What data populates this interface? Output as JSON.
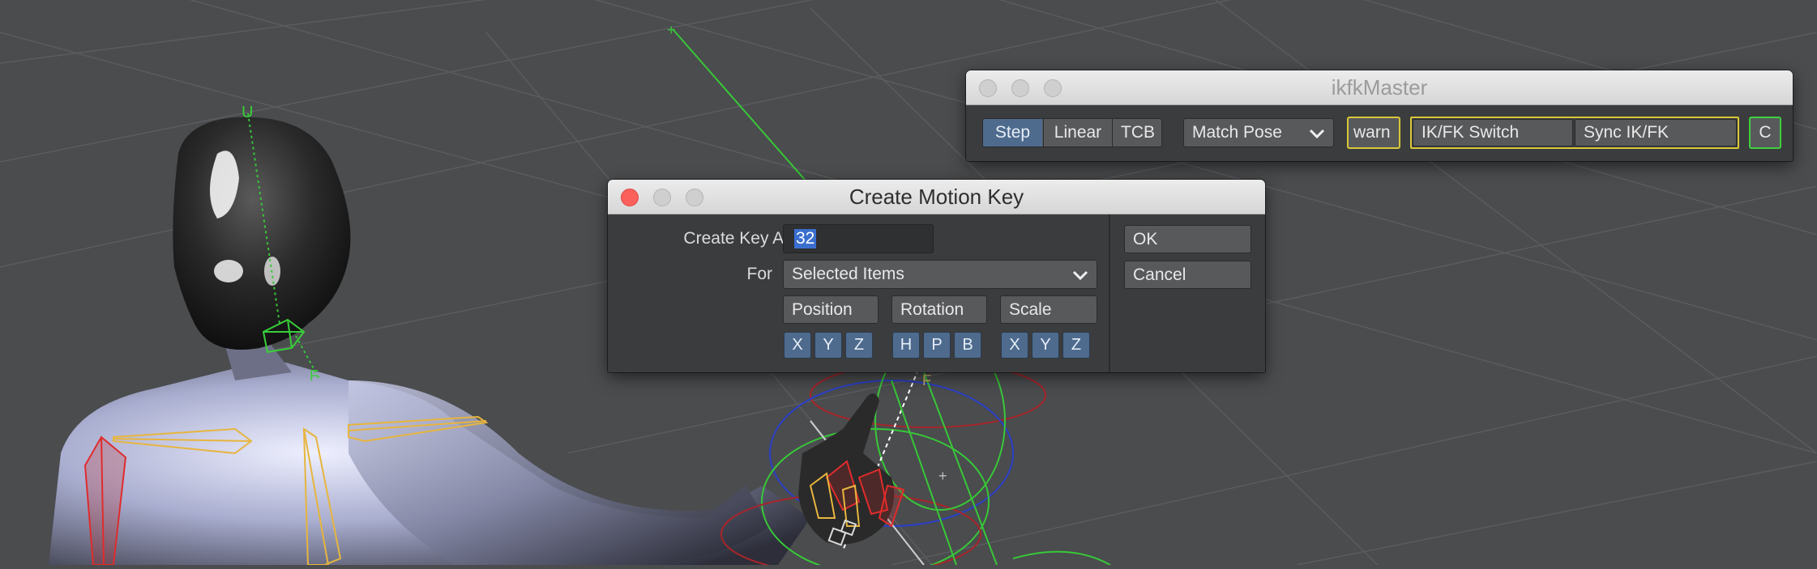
{
  "ikfk_window": {
    "title": "ikfkMaster",
    "interp_options": [
      "Step",
      "Linear",
      "TCB"
    ],
    "match_pose": "Match Pose",
    "warn": "warn",
    "ik_fk_switch": "IK/FK Switch",
    "sync_ik_fk": "Sync IK/FK",
    "c": "C"
  },
  "motion_dialog": {
    "title": "Create Motion Key",
    "create_key_at_label": "Create Key At",
    "create_key_at_value": "32",
    "for_label": "For",
    "for_value": "Selected Items",
    "ok": "OK",
    "cancel": "Cancel",
    "groups": [
      {
        "name": "Position",
        "axes": [
          "X",
          "Y",
          "Z"
        ]
      },
      {
        "name": "Rotation",
        "axes": [
          "H",
          "P",
          "B"
        ]
      },
      {
        "name": "Scale",
        "axes": [
          "X",
          "Y",
          "Z"
        ]
      }
    ]
  },
  "viewport_labels": {
    "u": "U",
    "f1": "F",
    "f2": "F"
  },
  "colors": {
    "viewport_bg": "#4a4c4e",
    "active_blue": "#4e6b8e",
    "warn_border": "#d8c838",
    "c_border": "#3ed13e",
    "bone_yellow": "#e7b53e",
    "bone_red": "#e02c2c",
    "bone_green": "#38d038",
    "figure": "#a7abcb"
  }
}
